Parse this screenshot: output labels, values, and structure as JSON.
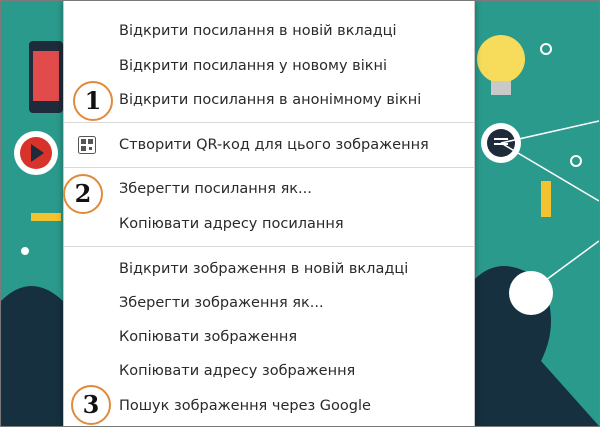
{
  "menu": {
    "group1": [
      "Відкрити посилання в новій вкладці",
      "Відкрити посилання у новому вікні",
      "Відкрити посилання в анонімному вікні"
    ],
    "qr": "Створити QR-код для цього зображення",
    "group2": [
      "Зберегти посилання як...",
      "Копіювати адресу посилання"
    ],
    "group3": [
      "Відкрити зображення в новій вкладці",
      "Зберегти зображення як...",
      "Копіювати зображення",
      "Копіювати адресу зображення",
      "Пошук зображення через Google"
    ]
  },
  "badges": [
    "1",
    "2",
    "3"
  ],
  "icons": {
    "qr": "qr-code-icon"
  },
  "colors": {
    "background": "#2a9a8c",
    "badge_border": "#e08a3c",
    "menu_text": "#2a2a2a"
  }
}
